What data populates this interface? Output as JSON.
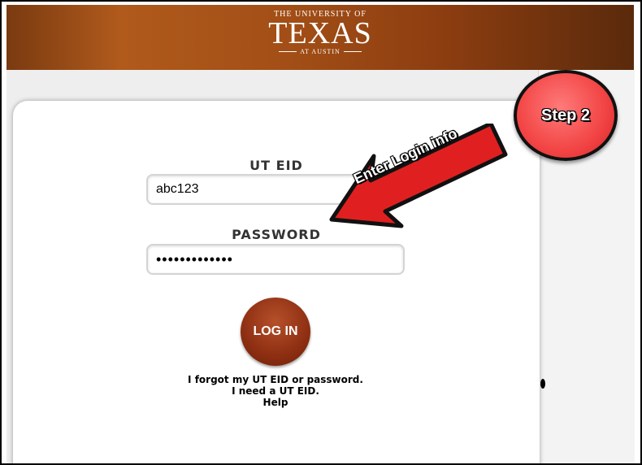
{
  "header": {
    "logo_top": "THE UNIVERSITY OF",
    "logo_main": "TEXAS",
    "logo_sub": "AT AUSTIN"
  },
  "form": {
    "eid_label": "UT EID",
    "eid_value": "abc123",
    "password_label": "PASSWORD",
    "password_value": "•••••••••••••",
    "login_button": "LOG IN"
  },
  "links": {
    "forgot": "I forgot my UT EID or password.",
    "need": "I need a UT EID.",
    "help": "Help"
  },
  "annotation": {
    "step": "Step 2",
    "arrow_text": "Enter Login info"
  },
  "colors": {
    "brand": "#a24e16",
    "button": "#8e2f12",
    "annotation": "#f24444"
  }
}
